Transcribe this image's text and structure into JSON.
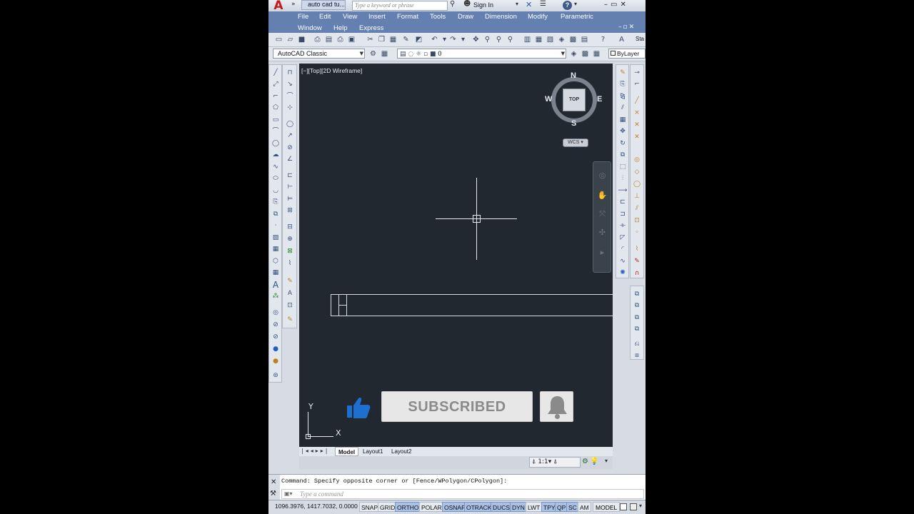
{
  "title_bar": {
    "doc_title": "auto cad tu...",
    "search_placeholder": "Type a keyword or phrase",
    "sign_in": "Sign In",
    "help_glyph": "?",
    "app_logo_letter": "A"
  },
  "menu": {
    "row1": [
      "File",
      "Edit",
      "View",
      "Insert",
      "Format",
      "Tools",
      "Draw",
      "Dimension",
      "Modify",
      "Parametric"
    ],
    "row2": [
      "Window",
      "Help",
      "Express"
    ]
  },
  "toolbar2": {
    "workspace": "AutoCAD Classic",
    "layer_value": "0",
    "color_value": "ByLayer",
    "right_text": "Sta"
  },
  "viewport": {
    "label": "[−][Top][2D Wireframe]",
    "compass": {
      "n": "N",
      "s": "S",
      "e": "E",
      "w": "W",
      "face": "TOP"
    },
    "wcs": "WCS",
    "ucs_y": "Y",
    "ucs_x": "X"
  },
  "layout_tabs": [
    "Model",
    "Layout1",
    "Layout2"
  ],
  "annotation_scale": "1:1",
  "command": {
    "history": "Command: Specify opposite corner or [Fence/WPolygon/CPolygon]:",
    "placeholder": "Type a command"
  },
  "status": {
    "coords": "1096.3976, 1417.7032, 0.0000",
    "toggles": [
      {
        "label": "SNAP",
        "on": false
      },
      {
        "label": "GRID",
        "on": false
      },
      {
        "label": "ORTHO",
        "on": true
      },
      {
        "label": "POLAR",
        "on": false
      },
      {
        "label": "OSNAP",
        "on": true
      },
      {
        "label": "OTRACK",
        "on": true
      },
      {
        "label": "DUCS",
        "on": true
      },
      {
        "label": "DYN",
        "on": true
      },
      {
        "label": "LWT",
        "on": false
      },
      {
        "label": "TPY",
        "on": true
      },
      {
        "label": "QP",
        "on": true
      },
      {
        "label": "SC",
        "on": true
      },
      {
        "label": "AM",
        "on": false
      }
    ],
    "model": "MODEL"
  },
  "overlay": {
    "subscribed": "SUBSCRIBED",
    "like_color": "#1f6fd1"
  },
  "colors": {
    "menubar": "#6480b0",
    "canvas": "#212830"
  }
}
